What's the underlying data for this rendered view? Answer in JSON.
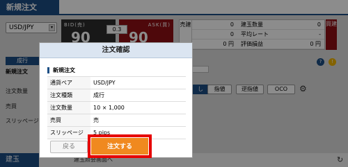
{
  "app": {
    "tab": "新規注文",
    "symbol": "USD/JPY",
    "bid": {
      "label": "BID(売)",
      "price": "90"
    },
    "ask": {
      "label": "ASK(買)",
      "price": "90"
    },
    "spread": "0.3",
    "stats_side": "売建",
    "stats": [
      {
        "v1": "0",
        "label": "建玉数量",
        "v2": "0"
      },
      {
        "v1": "0",
        "label": "平均レート",
        "v2": "-"
      },
      {
        "v1": "0 円",
        "label": "評価損益",
        "v2": "0 円"
      }
    ],
    "buy_side": "買建",
    "order_type_button": "成行",
    "left_tab": "新規注文",
    "left_labels": [
      "注文数量",
      "売買",
      "スリッページ"
    ],
    "order_types": [
      "し",
      "指値",
      "逆指値",
      "OCO"
    ],
    "help": "?",
    "warn": "!",
    "bottom_tab": "建玉",
    "bottom_link": "建玉照会画面へ",
    "refresh_icon": "↻",
    "gear_icon": "⚙"
  },
  "modal": {
    "title": "注文確認",
    "section": "新規注文",
    "rows": [
      {
        "k": "通貨ペア",
        "v": "USD/JPY"
      },
      {
        "k": "注文種類",
        "v": "成行"
      },
      {
        "k": "注文数量",
        "v": "10 × 1,000"
      },
      {
        "k": "売買",
        "v": "売"
      },
      {
        "k": "スリッページ",
        "v": "5 pips"
      }
    ],
    "back_label": "戻る",
    "confirm_label": "注文する"
  },
  "colors": {
    "brand": "#1c4e84",
    "ask": "#8e0f14",
    "confirm": "#f0891f",
    "highlight": "#e60000"
  }
}
